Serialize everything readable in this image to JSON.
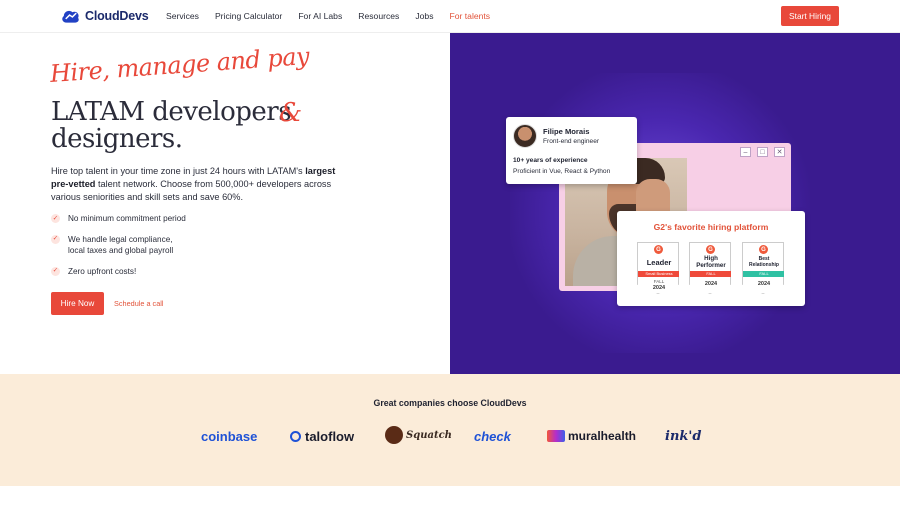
{
  "header": {
    "brand": "CloudDevs",
    "nav": [
      "Services",
      "Pricing Calculator",
      "For AI Labs",
      "Resources",
      "Jobs",
      "For talents"
    ],
    "cta": "Start Hiring"
  },
  "hero": {
    "script_line": "Hire, manage and pay",
    "headline_line1": "LATAM developers",
    "ampersand": "&",
    "headline_line2": "designers.",
    "desc_part1": "Hire top talent in your time zone in just 24 hours with LATAM's ",
    "desc_bold": "largest pre-vetted",
    "desc_part2": " talent network. Choose from 500,000+ developers across various seniorities and skill sets and save 60%.",
    "bullets": [
      "No minimum commitment period",
      "We handle legal compliance, local taxes and global payroll",
      "Zero upfront costs!"
    ],
    "primary_button": "Hire Now",
    "secondary_link": "Schedule a call"
  },
  "profile": {
    "name": "Filipe Morais",
    "role": "Front-end engineer",
    "experience": "10+ years of experience",
    "skills": "Proficient in Vue, React & Python"
  },
  "g2": {
    "title": "G2's favorite hiring platform",
    "badges": [
      {
        "title": "Leader",
        "band": "Small Business",
        "season": "FALL",
        "year": "2024",
        "color": "#ef4a3a"
      },
      {
        "title": "High Performer",
        "band": "FALL",
        "season": "",
        "year": "2024",
        "color": "#ef4a3a"
      },
      {
        "title": "Best Relationship",
        "band": "FALL",
        "season": "",
        "year": "2024",
        "color": "#2fc1a3"
      }
    ]
  },
  "companies": {
    "title": "Great companies choose CloudDevs",
    "logos": [
      "coinbase",
      "taloflow",
      "Squatch",
      "check",
      "muralhealth",
      "ink'd"
    ]
  },
  "colors": {
    "accent": "#e8483a",
    "hero_purple": "#3a1b8f",
    "band": "#fbecd9",
    "brand_navy": "#1b2a6b"
  }
}
